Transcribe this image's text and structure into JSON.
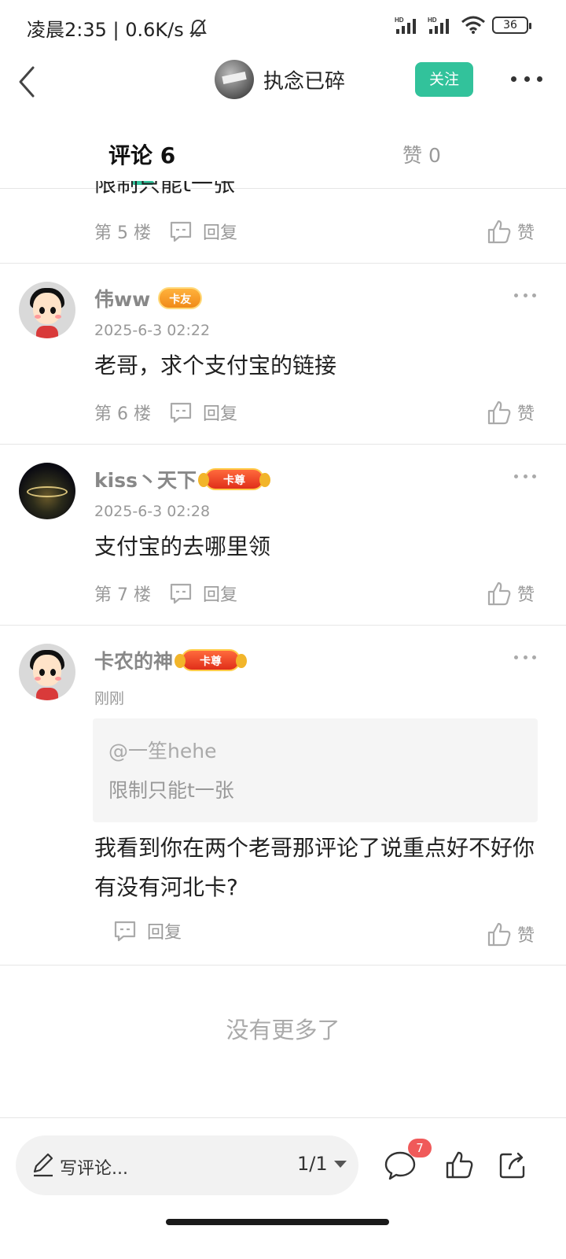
{
  "status_bar": {
    "time_speed": "凌晨2:35 | 0.6K/s",
    "battery": "36",
    "network_label": "HD"
  },
  "header": {
    "title": "执念已碎",
    "follow_label": "关注"
  },
  "tabs": {
    "comments_label": "评论 6",
    "likes_label": "赞 0"
  },
  "comments": [
    {
      "partial_text": "限制只能t一张",
      "floor": "第 5 楼",
      "reply_label": "回复",
      "like_label": "赞"
    },
    {
      "username": "伟ww",
      "badge": "卡友",
      "time": "2025-6-3 02:22",
      "text": "老哥，求个支付宝的链接",
      "floor": "第 6 楼",
      "reply_label": "回复",
      "like_label": "赞"
    },
    {
      "username": "kiss丶天下",
      "badge": "卡尊",
      "time": "2025-6-3 02:28",
      "text": "支付宝的去哪里领",
      "floor": "第 7 楼",
      "reply_label": "回复",
      "like_label": "赞"
    },
    {
      "username": "卡农的神",
      "badge": "卡尊",
      "time": "刚刚",
      "quote_user": "@一笙hehe",
      "quote_text": "限制只能t一张",
      "text": "我看到你在两个老哥那评论了说重点好不好你有没有河北卡?",
      "reply_label": "回复",
      "like_label": "赞"
    }
  ],
  "no_more": "没有更多了",
  "bottom_bar": {
    "write_label": "写评论...",
    "page": "1/1",
    "comment_count": "7"
  },
  "colors": {
    "accent": "#32c29b",
    "badge_red": "#f05a5a"
  }
}
